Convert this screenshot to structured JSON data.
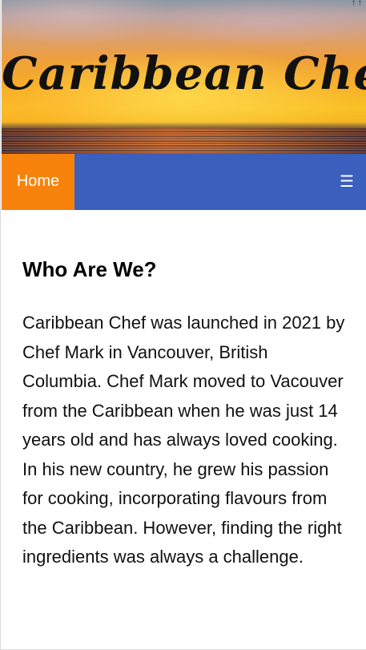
{
  "header": {
    "site_title": "Caribbean Chef",
    "corner_mark": "↑↑"
  },
  "nav": {
    "home_label": "Home",
    "menu_icon": "☰",
    "colors": {
      "bar": "#3a5fbd",
      "active": "#f7830c"
    }
  },
  "main": {
    "section_title": "Who Are We?",
    "section_body": "Caribbean Chef was launched in 2021 by Chef Mark in Vancouver, British Columbia. Chef Mark moved to Vacouver from the Caribbean when he was just 14 years old and has always loved cooking. In his new country, he grew his passion for cooking, incorporating flavours from the Caribbean. However, finding the right ingredients was always a challenge."
  }
}
